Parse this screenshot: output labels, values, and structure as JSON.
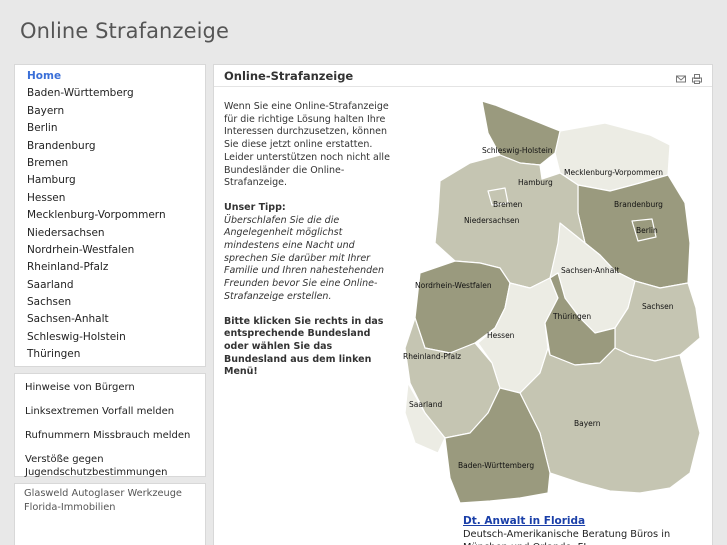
{
  "site_title": "Online Strafanzeige",
  "nav": [
    "Home",
    "Baden-Württemberg",
    "Bayern",
    "Berlin",
    "Brandenburg",
    "Bremen",
    "Hamburg",
    "Hessen",
    "Mecklenburg-Vorpommern",
    "Niedersachsen",
    "Nordrhein-Westfalen",
    "Rheinland-Pfalz",
    "Saarland",
    "Sachsen",
    "Sachsen-Anhalt",
    "Schleswig-Holstein",
    "Thüringen"
  ],
  "nav2": [
    "Hinweise von Bürgern",
    "Linksextremen Vorfall melden",
    "Rufnummern Missbrauch melden",
    "Verstöße gegen Jugendschutzbestimmungen"
  ],
  "ads": [
    "Glasweld Autoglaser Werkzeuge",
    "Florida-Immobilien"
  ],
  "main": {
    "heading": "Online-Strafanzeige",
    "intro": "Wenn Sie eine Online-Strafanzeige für die richtige Lösung halten Ihre Interessen durchzusetzen, können Sie diese jetzt online erstatten. Leider unterstützen noch nicht alle Bundesländer die Online-Strafanzeige.",
    "tip_title": "Unser Tipp:",
    "tip_text": "Überschlafen Sie die die Angelegenheit möglichst mindestens eine Nacht und sprechen Sie darüber mit Ihrer Familie und Ihren nahestehenden Freunden bevor Sie eine Online-Strafanzeige erstellen.",
    "instruction": "Bitte klicken Sie rechts in das entsprechende Bundesland oder wählen Sie das Bundesland aus dem linken Menü!"
  },
  "map_labels": {
    "sh": "Schleswig-Holstein",
    "hh": "Hamburg",
    "mv": "Mecklenburg-Vorpommern",
    "hb": "Bremen",
    "bb": "Brandenburg",
    "ni": "Niedersachsen",
    "be": "Berlin",
    "st": "Sachsen-Anhalt",
    "nw": "Nordrhein-Westfalen",
    "sn": "Sachsen",
    "he": "Hessen",
    "th": "Thüringen",
    "rp": "Rheinland-Pfalz",
    "sl": "Saarland",
    "by": "Bayern",
    "bw": "Baden-Württemberg"
  },
  "ad_link": {
    "title": "Dt. Anwalt in Florida",
    "text": "Deutsch-Amerikanische Beratung Büros in München und Orlando, FL"
  },
  "colors": {
    "dark": "#9a9a7e",
    "mid": "#c5c5b2",
    "light": "#ecece4",
    "accent": "#3a6fd8"
  }
}
